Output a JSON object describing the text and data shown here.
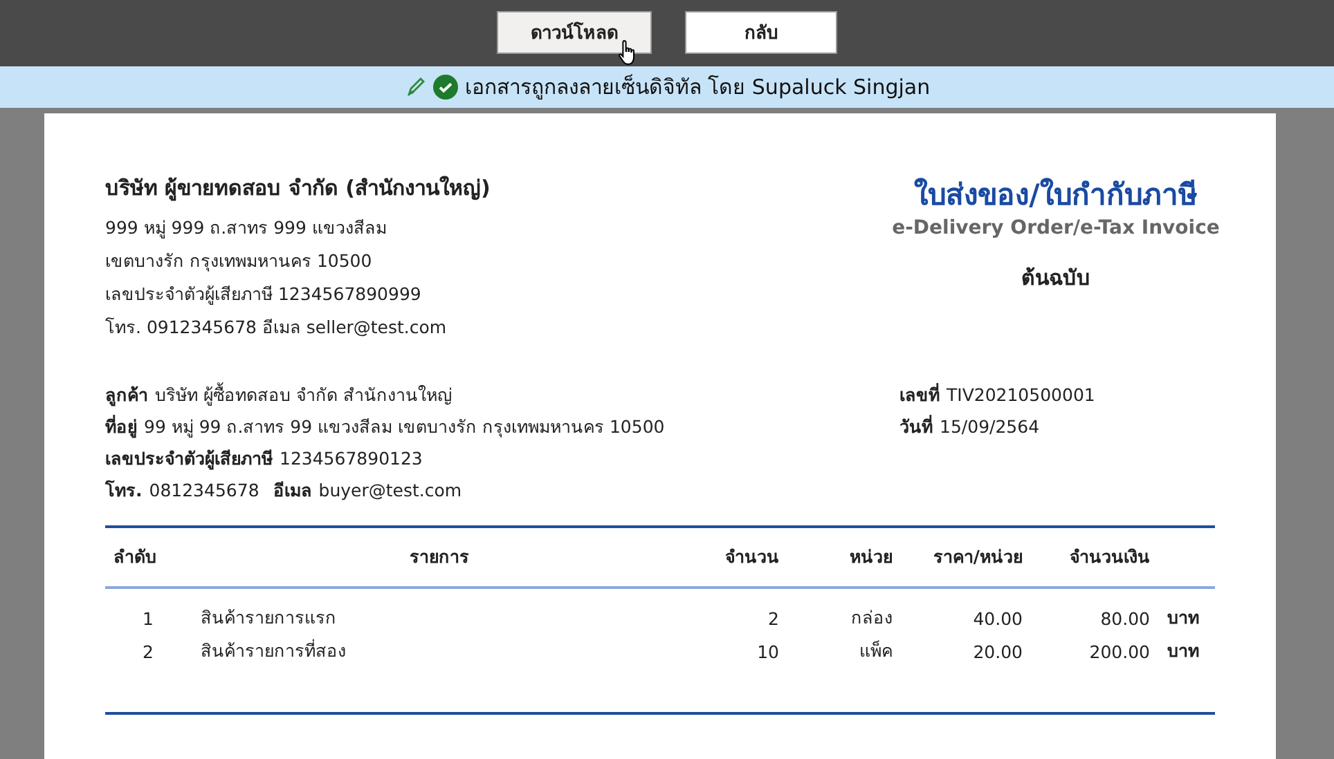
{
  "toolbar": {
    "buttons": [
      {
        "label": "ดาวน์โหลด",
        "kind": "download"
      },
      {
        "label": "กลับ",
        "kind": "back"
      }
    ]
  },
  "banner": {
    "text": "เอกสารถูกลงลายเซ็นดิจิทัล โดย Supaluck Singjan",
    "verified": true
  },
  "seller": {
    "name": "บริษัท ผู้ขายทดสอบ จำกัด (สำนักงานใหญ่)",
    "lines": [
      "999 หมู่ 999 ถ.สาทร 999 แขวงสีลม",
      "เขตบางรัก  กรุงเทพมหานคร 10500",
      "เลขประจำตัวผู้เสียภาษี 1234567890999",
      "โทร. 0912345678  อีเมล seller@test.com"
    ]
  },
  "document": {
    "title": "ใบส่งของ/ใบกำกับภาษี",
    "subtitle": "e-Delivery Order/e-Tax Invoice",
    "copy": "ต้นฉบับ"
  },
  "customer": [
    [
      {
        "label": "ลูกค้า",
        "value": "บริษัท ผู้ซื้อทดสอบ จำกัด  สำนักงานใหญ่"
      }
    ],
    [
      {
        "label": "ที่อยู่",
        "value": "99 หมู่ 99 ถ.สาทร 99 แขวงสีลม เขตบางรัก กรุงเทพมหานคร 10500"
      }
    ],
    [
      {
        "label": "เลขประจำตัวผู้เสียภาษี",
        "value": "1234567890123"
      }
    ],
    [
      {
        "label": "โทร.",
        "value": "0812345678"
      },
      {
        "label": "อีเมล",
        "value": "buyer@test.com"
      }
    ]
  ],
  "doc_info": [
    {
      "label": "เลขที่",
      "value": "TIV20210500001"
    },
    {
      "label": "วันที่",
      "value": "15/09/2564"
    }
  ],
  "table": {
    "columns": [
      "ลำดับ",
      "รายการ",
      "จำนวน",
      "หน่วย",
      "ราคา/หน่วย",
      "จำนวนเงิน"
    ],
    "rows": [
      {
        "no": "1",
        "item": "สินค้ารายการแรก",
        "qty": "2",
        "unit": "กล่อง",
        "price": "40.00",
        "amount": "80.00",
        "currency": "บาท"
      },
      {
        "no": "2",
        "item": "สินค้ารายการที่สอง",
        "qty": "10",
        "unit": "แพ็ค",
        "price": "20.00",
        "amount": "200.00",
        "currency": "บาท"
      }
    ]
  }
}
